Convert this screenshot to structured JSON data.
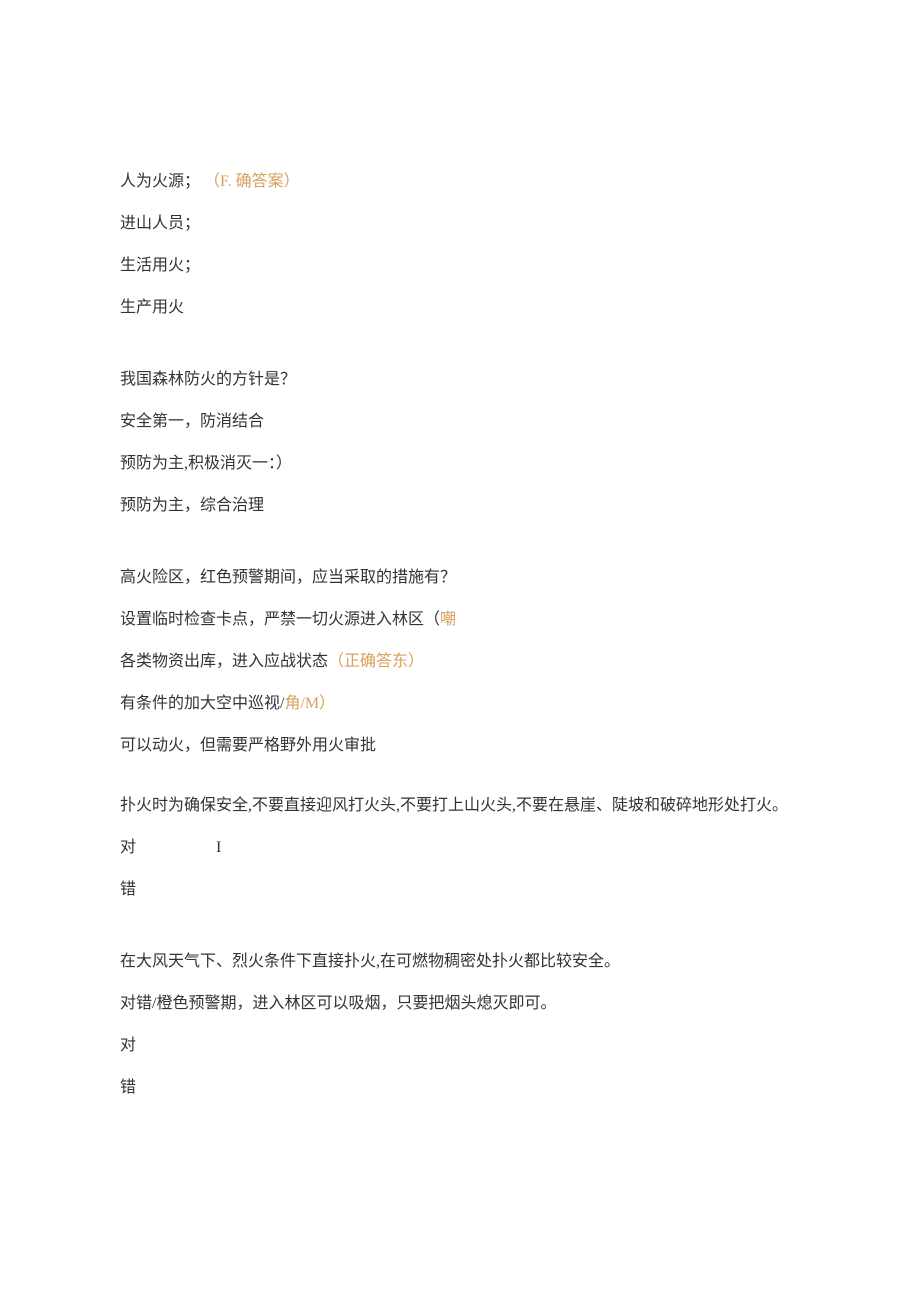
{
  "q1": {
    "opt_a_text": "人为火源；",
    "opt_a_ann": "（F. 确答案）",
    "opt_b": "进山人员；",
    "opt_c": "生活用火；",
    "opt_d": "生产用火"
  },
  "q2": {
    "prompt": "我国森林防火的方针是？",
    "opt_a": "安全第一，防消结合",
    "opt_b": "预防为主,积极消灭一：）",
    "opt_c": "预防为主，综合治理"
  },
  "q3": {
    "prompt": "高火险区，红色预警期间，应当采取的措施有？",
    "opt_a_text": "设置临时检查卡点，严禁一切火源进入林区（",
    "opt_a_ann": "嘲",
    "opt_b_text": "各类物资出库，进入应战状态",
    "opt_b_ann": "（正确答东）",
    "opt_c_text": "有条件的加大空中巡视/",
    "opt_c_ann": "角/M）",
    "opt_d": "可以动火，但需要严格野外用火审批"
  },
  "q4": {
    "prompt": "扑火时为确保安全,不要直接迎风打火头,不要打上山火头,不要在悬崖、陡坡和破碎地形处打火。",
    "true_label": "对",
    "true_marker": "I",
    "false_label": "错"
  },
  "q5": {
    "line1": "在大风天气下、烈火条件下直接扑火,在可燃物稠密处扑火都比较安全。",
    "line2": "对错/橙色预警期，进入林区可以吸烟，只要把烟头熄灭即可。",
    "true_label": "对",
    "false_label": "错"
  }
}
